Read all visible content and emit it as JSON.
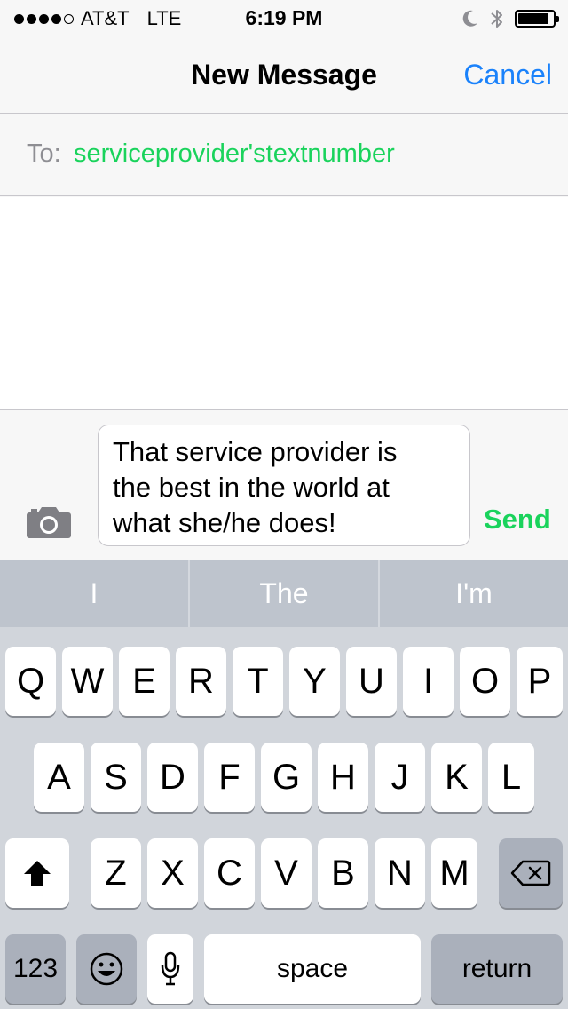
{
  "status_bar": {
    "signal_dots": [
      true,
      true,
      true,
      true,
      false
    ],
    "carrier": "AT&T",
    "network": "LTE",
    "time": "6:19 PM",
    "icons": [
      "moon-icon",
      "bluetooth-icon",
      "battery-icon"
    ],
    "battery_level": 0.9
  },
  "nav": {
    "title": "New Message",
    "cancel_label": "Cancel"
  },
  "to_field": {
    "label": "To:",
    "value": "serviceprovider'stextnumber"
  },
  "compose": {
    "message_lines": [
      "That service provider is",
      "the best in the world at",
      "what she/he does!"
    ],
    "send_label": "Send",
    "camera_icon": "camera-icon"
  },
  "predictions": [
    "I",
    "The",
    "I'm"
  ],
  "keyboard": {
    "row1": [
      "Q",
      "W",
      "E",
      "R",
      "T",
      "Y",
      "U",
      "I",
      "O",
      "P"
    ],
    "row2": [
      "A",
      "S",
      "D",
      "F",
      "G",
      "H",
      "J",
      "K",
      "L"
    ],
    "row3": [
      "Z",
      "X",
      "C",
      "V",
      "B",
      "N",
      "M"
    ],
    "numbers_label": "123",
    "space_label": "space",
    "return_label": "return",
    "icons": [
      "shift-icon",
      "delete-icon",
      "emoji-icon",
      "microphone-icon"
    ]
  },
  "colors": {
    "accent_blue": "#1a82fb",
    "accent_green": "#1ad35c",
    "keyboard_bg": "#d1d5db",
    "prediction_bg": "#bec4cd"
  }
}
